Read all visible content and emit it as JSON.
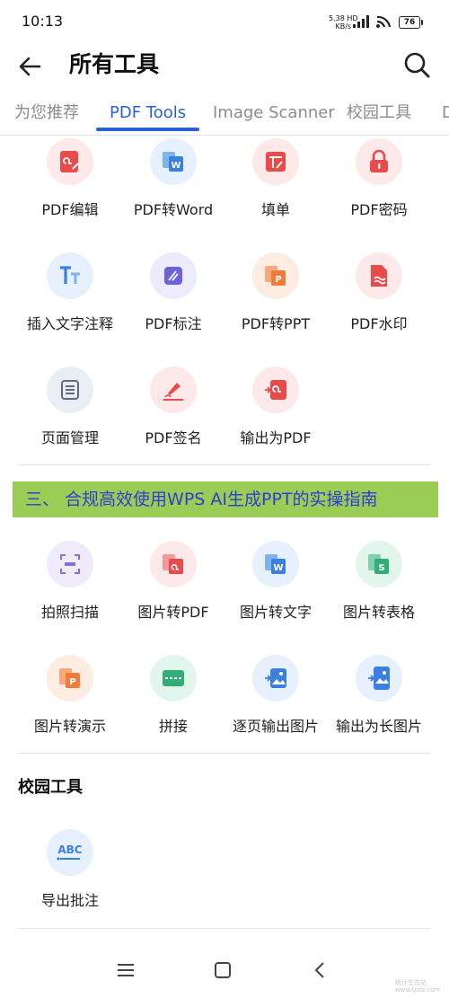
{
  "status": {
    "time": "10:13",
    "speed_value": "5.38",
    "speed_unit": "KB/s",
    "hd": "HD",
    "battery": "76"
  },
  "header": {
    "title": "所有工具"
  },
  "tabs": [
    {
      "label": "为您推荐"
    },
    {
      "label": "PDF Tools"
    },
    {
      "label": "Image Scanner"
    },
    {
      "label": "校园工具"
    },
    {
      "label": "D"
    }
  ],
  "active_tab": "PDF Tools",
  "pdf_tools": [
    {
      "label": "PDF编辑",
      "icon": "pdf-edit-icon"
    },
    {
      "label": "PDF转Word",
      "icon": "pdf-to-word-icon"
    },
    {
      "label": "填单",
      "icon": "fill-form-icon"
    },
    {
      "label": "PDF密码",
      "icon": "lock-icon"
    },
    {
      "label": "插入文字注释",
      "icon": "text-annotation-icon"
    },
    {
      "label": "PDF标注",
      "icon": "pdf-markup-icon"
    },
    {
      "label": "PDF转PPT",
      "icon": "pdf-to-ppt-icon"
    },
    {
      "label": "PDF水印",
      "icon": "watermark-icon"
    },
    {
      "label": "页面管理",
      "icon": "page-manage-icon"
    },
    {
      "label": "PDF签名",
      "icon": "signature-icon"
    },
    {
      "label": "输出为PDF",
      "icon": "export-pdf-icon"
    }
  ],
  "banner": {
    "text": "三、 合规高效使用WPS AI生成PPT的实操指南"
  },
  "image_tools": [
    {
      "label": "拍照扫描",
      "icon": "scan-icon"
    },
    {
      "label": "图片转PDF",
      "icon": "image-to-pdf-icon"
    },
    {
      "label": "图片转文字",
      "icon": "image-to-text-icon"
    },
    {
      "label": "图片转表格",
      "icon": "image-to-sheet-icon"
    },
    {
      "label": "图片转演示",
      "icon": "image-to-slides-icon"
    },
    {
      "label": "拼接",
      "icon": "stitch-icon"
    },
    {
      "label": "逐页输出图片",
      "icon": "export-pages-image-icon"
    },
    {
      "label": "输出为长图片",
      "icon": "export-long-image-icon"
    }
  ],
  "campus_section": {
    "title": "校园工具"
  },
  "campus_tools": [
    {
      "label": "导出批注",
      "icon": "abc-export-icon"
    }
  ],
  "watermark": {
    "line1": "统计生态站",
    "line2": "www.tjstz.com"
  },
  "colors": {
    "accent": "#2b5fd9",
    "red": "#e94a4a",
    "blue": "#3b7fe0",
    "orange": "#f07b3a",
    "green": "#2fae78",
    "purple": "#7a5fd9",
    "banner_bg": "#9bcc55",
    "banner_text": "#2b3fd0"
  }
}
